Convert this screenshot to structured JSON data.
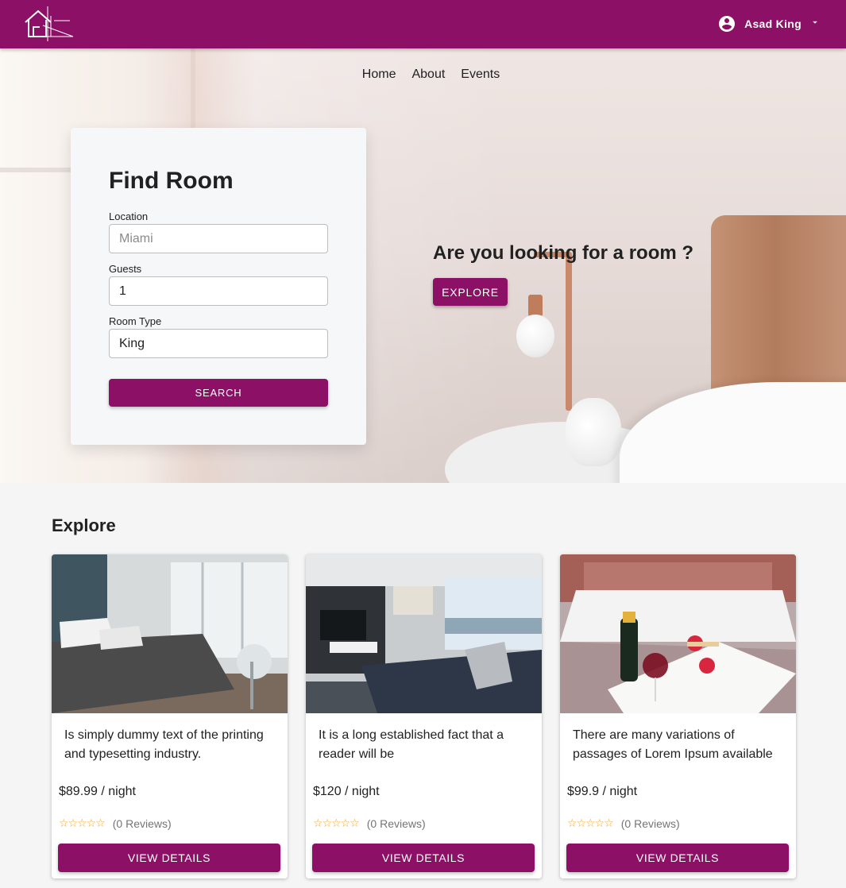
{
  "brand": {
    "color": "#8c1066"
  },
  "header": {
    "logo_icon": "house-logo-icon",
    "user": {
      "icon": "account-circle-icon",
      "name": "Asad King",
      "dropdown_icon": "caret-down-icon"
    }
  },
  "nav": {
    "items": [
      "Home",
      "About",
      "Events"
    ]
  },
  "find_room": {
    "title": "Find Room",
    "location": {
      "label": "Location",
      "value": "",
      "placeholder": "Miami"
    },
    "guests": {
      "label": "Guests",
      "value": "1"
    },
    "room_type": {
      "label": "Room Type",
      "value": "King"
    },
    "search_label": "SEARCH"
  },
  "hero": {
    "question": "Are you looking for a room ?",
    "explore_label": "EXPLORE"
  },
  "explore": {
    "heading": "Explore",
    "cards": [
      {
        "description": "Is simply dummy text of the printing and typesetting industry.",
        "price": "$89.99 / night",
        "rating": 0,
        "reviews": "(0 Reviews)",
        "button": "VIEW DETAILS"
      },
      {
        "description": "It is a long established fact that a reader will be",
        "price": "$120 / night",
        "rating": 0,
        "reviews": "(0 Reviews)",
        "button": "VIEW DETAILS"
      },
      {
        "description": "There are many variations of passages of Lorem Ipsum available",
        "price": "$99.9 / night",
        "rating": 0,
        "reviews": "(0 Reviews)",
        "button": "VIEW DETAILS"
      }
    ]
  }
}
